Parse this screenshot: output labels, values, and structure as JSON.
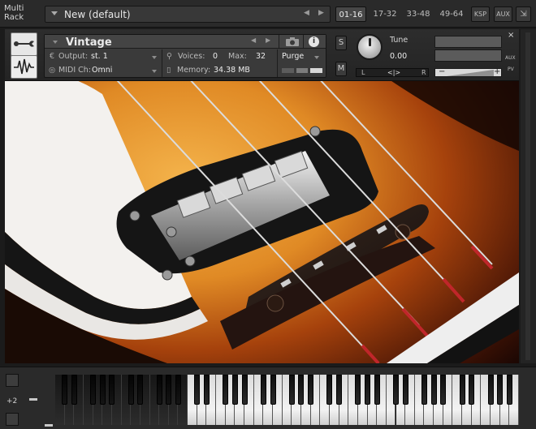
{
  "multirack": {
    "label_line1": "Multi",
    "label_line2": "Rack",
    "preset_name": "New (default)",
    "prev_arrow": "◀",
    "next_arrow": "▶",
    "ranges": [
      "01-16",
      "17-32",
      "33-48",
      "49-64"
    ],
    "active_range": "01-16",
    "ksp_label": "KSP",
    "aux_label": "AUX",
    "collapse_label": "⇲"
  },
  "instrument": {
    "name": "Vintage",
    "output_label": "Output:",
    "output_value": "st. 1",
    "voices_label": "Voices:",
    "voices_value": "0",
    "max_label": "Max:",
    "max_value": "32",
    "purge_label": "Purge",
    "midi_label": "MIDI Ch:",
    "midi_value": "Omni",
    "memory_label": "Memory:",
    "memory_value": "34.38 MB",
    "solo_label": "S",
    "mute_label": "M",
    "tune_label": "Tune",
    "tune_value": "0.00",
    "pan_left": "L",
    "pan_center": "<|>",
    "pan_right": "R",
    "vol_minus": "−",
    "vol_plus": "+",
    "close_label": "×",
    "aux_label": "AUX",
    "pv_label": "PV",
    "info_label": "i",
    "tune_level": 0.5,
    "volume_level": 0.6
  },
  "keyboard": {
    "octave_label": "+2",
    "minus_label": "−"
  },
  "colors": {
    "accent_gold": "#e9a33a",
    "panel_bg": "#3a3a3a",
    "key_white": "#efefef",
    "key_black": "#161616"
  }
}
